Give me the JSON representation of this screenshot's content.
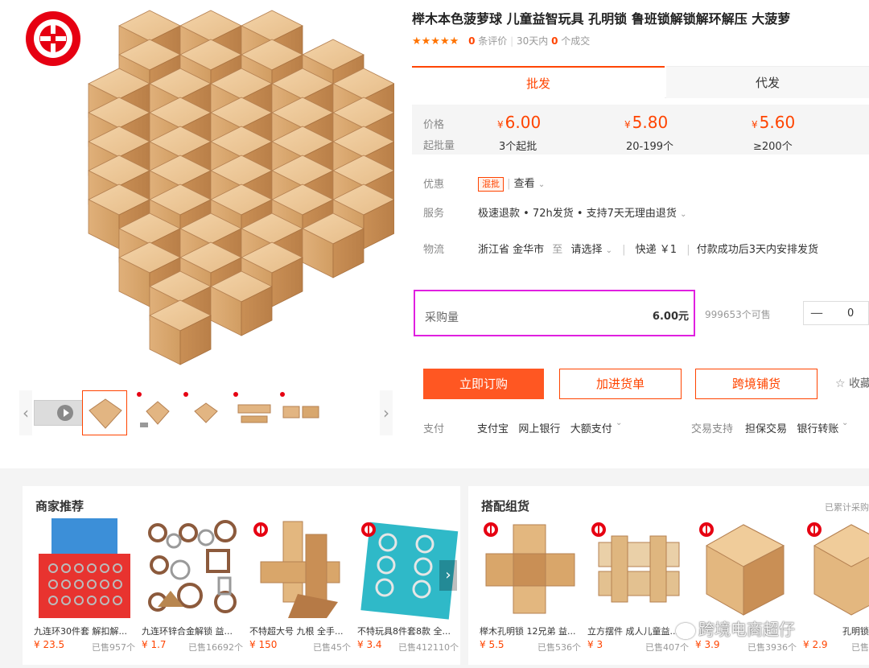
{
  "product": {
    "title": "榉木本色菠萝球 儿童益智玩具 孔明锁 鲁班锁解锁解环解压 大菠萝",
    "stars": "★★★★★",
    "review_count": "0",
    "review_label": "条评价",
    "sold_30d_label": "30天内",
    "sold_30d_count": "0",
    "sold_30d_unit": "个成交"
  },
  "tabs": {
    "wholesale": "批发",
    "dropship": "代发"
  },
  "price": {
    "price_label": "价格",
    "moq_label": "起批量",
    "currency": "¥",
    "tiers": [
      {
        "price": "6.00",
        "range": "3个起批"
      },
      {
        "price": "5.80",
        "range": "20-199个"
      },
      {
        "price": "5.60",
        "range": "≥200个"
      }
    ]
  },
  "attrs": {
    "discount_label": "优惠",
    "discount_tag": "混批",
    "discount_link": "查看",
    "service_label": "服务",
    "service_value": "极速退款 • 72h发货 • 支持7天无理由退货",
    "logistics_label": "物流",
    "from": "浙江省 金华市",
    "to_label": "至",
    "dest": "请选择",
    "express": "快递 ￥1",
    "ship_note": "付款成功后3天内安排发货"
  },
  "purchase": {
    "qty_label": "采购量",
    "total": "6.00元",
    "stock": "999653个可售",
    "qty_value": "0",
    "minus": "—"
  },
  "buttons": {
    "buy": "立即订购",
    "cart": "加进货单",
    "cross": "跨境铺货",
    "fav": "收藏"
  },
  "pay": {
    "label": "支付",
    "methods": "支付宝   网上银行   大额支付",
    "support_label": "交易支持",
    "support": "担保交易   银行转账"
  },
  "merchant": {
    "title": "商家推荐",
    "items": [
      {
        "name": "九连环30件套 解扣解...",
        "price": "¥ 23.5",
        "sold": "已售957个"
      },
      {
        "name": "九连环锌合金解锁 益...",
        "price": "¥ 1.7",
        "sold": "已售16692个"
      },
      {
        "name": "不特超大号 九根 全手...",
        "price": "¥ 150",
        "sold": "已售45个"
      },
      {
        "name": "不特玩具8件套8款 全...",
        "price": "¥ 3.4",
        "sold": "已售412110个"
      }
    ]
  },
  "bundle": {
    "title": "搭配组货",
    "cumulative": "已累计采购",
    "items": [
      {
        "name": "榉木孔明锁 12兄弟 益...",
        "price": "¥ 5.5",
        "sold": "已售536个"
      },
      {
        "name": "立方摆件 成人儿童益...",
        "price": "¥ 3",
        "sold": "已售407个"
      },
      {
        "name": "",
        "price": "¥ 3.9",
        "sold": "已售3936个"
      },
      {
        "name": "孔明锁",
        "price": "¥ 2.9",
        "sold": "已售"
      }
    ]
  },
  "watermark": "跨境电商超仔",
  "colors": {
    "accent": "#ff4400",
    "highlight": "#e020e0",
    "wood": "#e2b582"
  }
}
